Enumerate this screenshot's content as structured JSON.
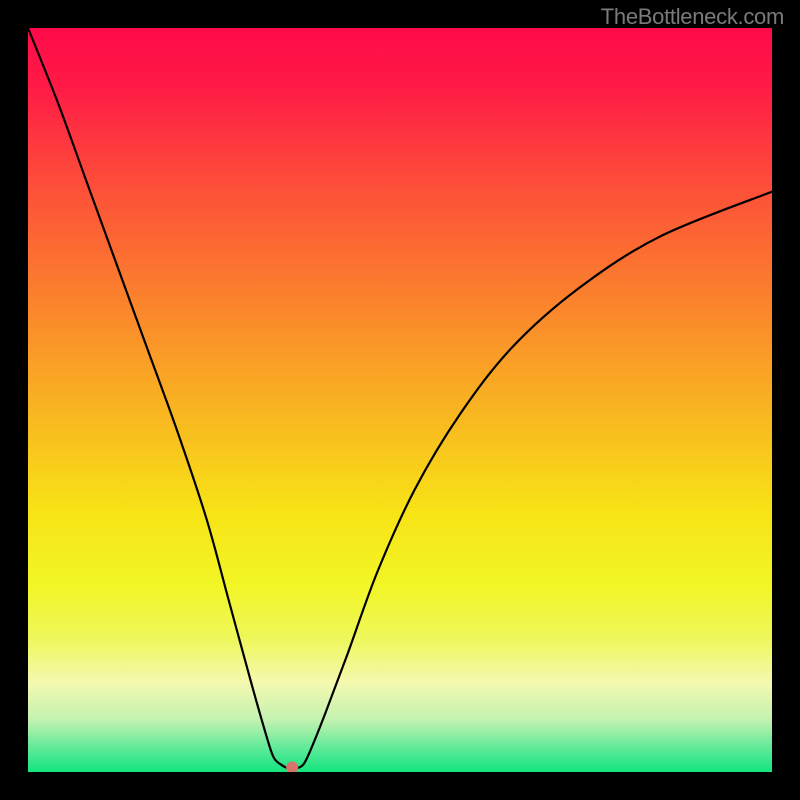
{
  "watermark": "TheBottleneck.com",
  "chart_data": {
    "type": "line",
    "title": "",
    "xlabel": "",
    "ylabel": "",
    "xlim": [
      0,
      100
    ],
    "ylim": [
      0,
      100
    ],
    "grid": false,
    "legend": false,
    "background": {
      "type": "vertical-gradient",
      "stops": [
        {
          "pos": 0.0,
          "color": "#ff0a49"
        },
        {
          "pos": 0.08,
          "color": "#ff1b46"
        },
        {
          "pos": 0.2,
          "color": "#fd4a3a"
        },
        {
          "pos": 0.35,
          "color": "#fb7d2e"
        },
        {
          "pos": 0.5,
          "color": "#f9b022"
        },
        {
          "pos": 0.65,
          "color": "#f7e316"
        },
        {
          "pos": 0.75,
          "color": "#f2f626"
        },
        {
          "pos": 0.82,
          "color": "#eef75a"
        },
        {
          "pos": 0.88,
          "color": "#f4f9b0"
        },
        {
          "pos": 0.93,
          "color": "#c3f2b0"
        },
        {
          "pos": 0.97,
          "color": "#5ae998"
        },
        {
          "pos": 1.0,
          "color": "#13e57f"
        }
      ]
    },
    "series": [
      {
        "name": "bottleneck-curve",
        "color": "#000000",
        "stroke_width": 2.2,
        "x": [
          0,
          4,
          8,
          12,
          16,
          20,
          24,
          27,
          30,
          32,
          33,
          34,
          35,
          36,
          37,
          38,
          40,
          43,
          47,
          52,
          58,
          65,
          74,
          85,
          100
        ],
        "values": [
          100,
          90,
          79,
          68,
          57,
          46,
          34,
          23,
          12,
          5,
          2,
          1,
          0.5,
          0.5,
          1,
          3,
          8,
          16,
          27,
          38,
          48,
          57,
          65,
          72,
          78
        ]
      }
    ],
    "marker": {
      "name": "target-point",
      "x": 35.5,
      "y": 0.6,
      "color": "#d9726a",
      "radius": 6
    }
  }
}
